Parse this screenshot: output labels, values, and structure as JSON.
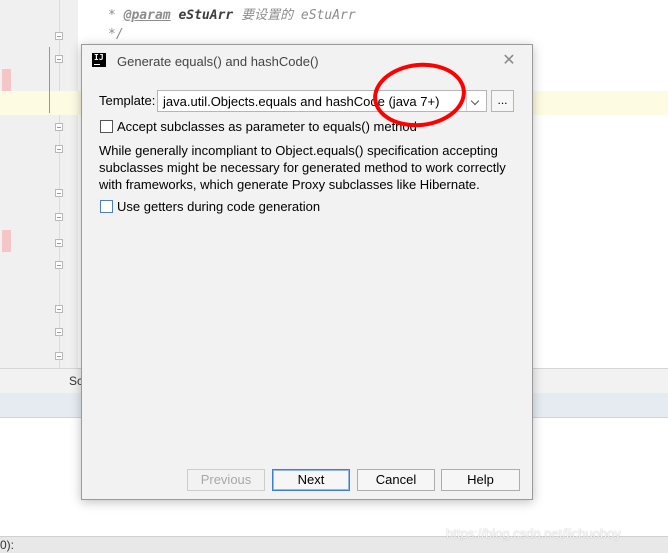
{
  "editor": {
    "code_lines": [
      {
        "prefix": "* ",
        "tag": "@param",
        "param": "eStuArr",
        "text": "要设置的 eStuArr"
      },
      {
        "prefix": "*/",
        "tag": "",
        "param": "",
        "text": ""
      }
    ]
  },
  "tool_strip": {
    "label": "Sc"
  },
  "status_bar": {
    "text": "0):"
  },
  "watermark": "https://blog.csdn.net/lichuoboy",
  "dialog": {
    "title": "Generate equals() and hashCode()",
    "app_icon": "intellij-icon",
    "app_icon_text": "IJ",
    "close_icon": "close-icon",
    "close_glyph": "✕",
    "template_label": "Template:",
    "template_value": "java.util.Objects.equals and hashCode (java 7+)",
    "browse_label": "...",
    "accept_subclasses_label": "Accept subclasses as parameter to equals() method",
    "accept_subclasses_checked": false,
    "info_text": "While generally incompliant to Object.equals() specification accepting subclasses might be necessary for generated method to work correctly with frameworks, which generate Proxy subclasses like Hibernate.",
    "use_getters_label": "Use getters during code generation",
    "use_getters_checked": false,
    "buttons": {
      "previous": "Previous",
      "next": "Next",
      "cancel": "Cancel",
      "help": "Help"
    }
  },
  "colors": {
    "annotation": "#ff0000",
    "default_button_border": "#3c7fd1",
    "dialog_bg": "#f2f2f2"
  }
}
